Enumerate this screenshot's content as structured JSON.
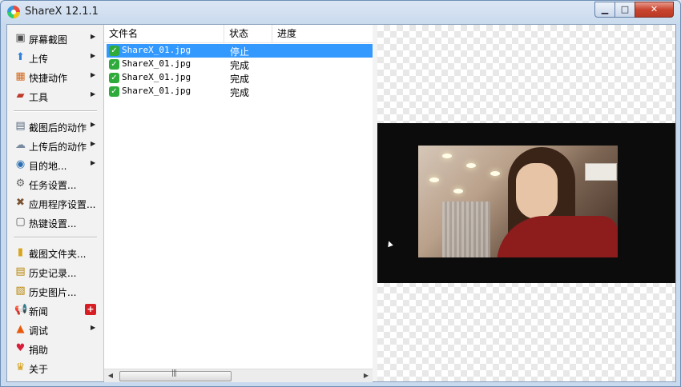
{
  "window": {
    "title": "ShareX 12.1.1",
    "controls": {
      "minimize": "▁",
      "maximize": "□",
      "close": "✕"
    }
  },
  "sidebar": {
    "groups": [
      [
        {
          "label": "屏幕截图",
          "icon": "monitor-capture-icon",
          "glyph": "▣",
          "color": "#4a4a4a",
          "submenu": true
        },
        {
          "label": "上传",
          "icon": "upload-arrow-icon",
          "glyph": "⬆",
          "color": "#2f7ed8",
          "submenu": true
        },
        {
          "label": "快捷动作",
          "icon": "grid-actions-icon",
          "glyph": "▦",
          "color": "#d2691e",
          "submenu": true
        },
        {
          "label": "工具",
          "icon": "toolbox-icon",
          "glyph": "▰",
          "color": "#c0392b",
          "submenu": true
        }
      ],
      [
        {
          "label": "截图后的动作",
          "icon": "after-capture-icon",
          "glyph": "▤",
          "color": "#5b6b80",
          "submenu": true
        },
        {
          "label": "上传后的动作",
          "icon": "cloud-upload-icon",
          "glyph": "☁",
          "color": "#7a8aa0",
          "submenu": true
        },
        {
          "label": "目的地...",
          "icon": "destination-globe-icon",
          "glyph": "◉",
          "color": "#2b6fb3",
          "submenu": true
        },
        {
          "label": "任务设置...",
          "icon": "gear-icon",
          "glyph": "⚙",
          "color": "#666666",
          "submenu": false
        },
        {
          "label": "应用程序设置...",
          "icon": "wrench-screwdriver-icon",
          "glyph": "✖",
          "color": "#7a5230",
          "submenu": false
        },
        {
          "label": "热键设置...",
          "icon": "keyboard-key-icon",
          "glyph": "▢",
          "color": "#555555",
          "submenu": false
        }
      ],
      [
        {
          "label": "截图文件夹...",
          "icon": "folder-icon",
          "glyph": "▮",
          "color": "#d9a520",
          "submenu": false
        },
        {
          "label": "历史记录...",
          "icon": "history-list-icon",
          "glyph": "▤",
          "color": "#b8860b",
          "submenu": false
        },
        {
          "label": "历史图片...",
          "icon": "image-history-icon",
          "glyph": "▧",
          "color": "#b8860b",
          "submenu": false
        },
        {
          "label": "新闻",
          "icon": "megaphone-icon",
          "glyph": "📢",
          "color": "#444444",
          "submenu": false,
          "badge": "+"
        },
        {
          "label": "调试",
          "icon": "traffic-cone-icon",
          "glyph": "▲",
          "color": "#e8590c",
          "submenu": true
        },
        {
          "label": "捐助",
          "icon": "heart-icon",
          "glyph": "♥",
          "color": "#d81e3a",
          "submenu": false
        },
        {
          "label": "关于",
          "icon": "crown-icon",
          "glyph": "♛",
          "color": "#d4a017",
          "submenu": false
        }
      ]
    ]
  },
  "list": {
    "columns": [
      "文件名",
      "状态",
      "进度"
    ],
    "rows": [
      {
        "filename": "ShareX_01.jpg",
        "status": "停止",
        "selected": true
      },
      {
        "filename": "ShareX_01.jpg",
        "status": "完成",
        "selected": false
      },
      {
        "filename": "ShareX_01.jpg",
        "status": "完成",
        "selected": false
      },
      {
        "filename": "ShareX_01.jpg",
        "status": "完成",
        "selected": false
      }
    ],
    "scroll": {
      "left": "◀",
      "right": "▶",
      "grip": "|||"
    }
  },
  "preview": {
    "image": "portrait-photo"
  },
  "colors": {
    "selection": "#3399ff",
    "check": "#2eab3a",
    "badge": "#d81e25"
  }
}
